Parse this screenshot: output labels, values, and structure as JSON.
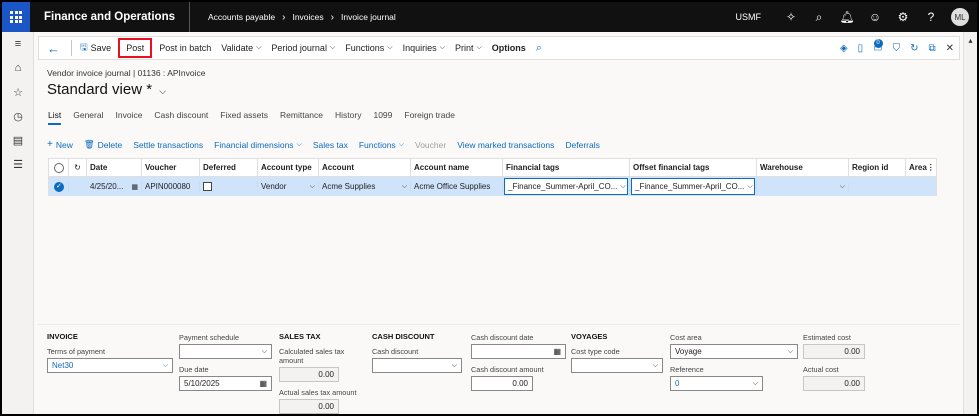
{
  "app": {
    "title": "Finance and Operations",
    "breadcrumbs": [
      "Accounts payable",
      "Invoices",
      "Invoice journal"
    ],
    "company": "USMF",
    "user_initials": "ML",
    "notification_count": "0"
  },
  "action_pane": {
    "save": "Save",
    "post": "Post",
    "post_in_batch": "Post in batch",
    "validate": "Validate",
    "period_journal": "Period journal",
    "functions": "Functions",
    "inquiries": "Inquiries",
    "print": "Print",
    "options": "Options"
  },
  "header": {
    "subtitle": "Vendor invoice journal  |  01136 : APInvoice",
    "view_title": "Standard view *"
  },
  "tabs": [
    "List",
    "General",
    "Invoice",
    "Cash discount",
    "Fixed assets",
    "Remittance",
    "History",
    "1099",
    "Foreign trade"
  ],
  "grid_toolbar": {
    "new": "New",
    "delete": "Delete",
    "settle": "Settle transactions",
    "fin_dims": "Financial dimensions",
    "sales_tax": "Sales tax",
    "functions": "Functions",
    "voucher": "Voucher",
    "view_marked": "View marked transactions",
    "deferrals": "Deferrals"
  },
  "grid": {
    "columns": [
      "Date",
      "Voucher",
      "Deferred",
      "Account type",
      "Account",
      "Account name",
      "Financial tags",
      "Offset financial tags",
      "Warehouse",
      "Region id",
      "Area"
    ],
    "row": {
      "date": "4/25/20...",
      "voucher": "APIN000080",
      "account_type": "Vendor",
      "account": "Acme Supplies",
      "account_name": "Acme Office Supplies",
      "financial_tags": "_Finance_Summer-April_CO...",
      "offset_financial_tags": "_Finance_Summer-April_CO..."
    }
  },
  "invoice_section": {
    "title": "INVOICE",
    "terms_label": "Terms of payment",
    "terms_value": "Net30",
    "schedule_label": "Payment schedule",
    "schedule_value": "",
    "due_label": "Due date",
    "due_value": "5/10/2025"
  },
  "sales_tax_section": {
    "title": "SALES TAX",
    "calc_label": "Calculated sales tax amount",
    "calc_value": "0.00",
    "actual_label": "Actual sales tax amount",
    "actual_value": "0.00"
  },
  "cash_discount_section": {
    "title": "CASH DISCOUNT",
    "cd_label": "Cash discount",
    "cd_value": "",
    "cd_date_label": "Cash discount date",
    "cd_date_value": "",
    "cd_amount_label": "Cash discount amount",
    "cd_amount_value": "0.00"
  },
  "voyages_section": {
    "title": "VOYAGES",
    "cost_type_label": "Cost type code",
    "cost_type_value": "",
    "cost_area_label": "Cost area",
    "cost_area_value": "Voyage",
    "reference_label": "Reference",
    "reference_value": "0",
    "est_cost_label": "Estimated cost",
    "est_cost_value": "0.00",
    "actual_cost_label": "Actual cost",
    "actual_cost_value": "0.00"
  }
}
